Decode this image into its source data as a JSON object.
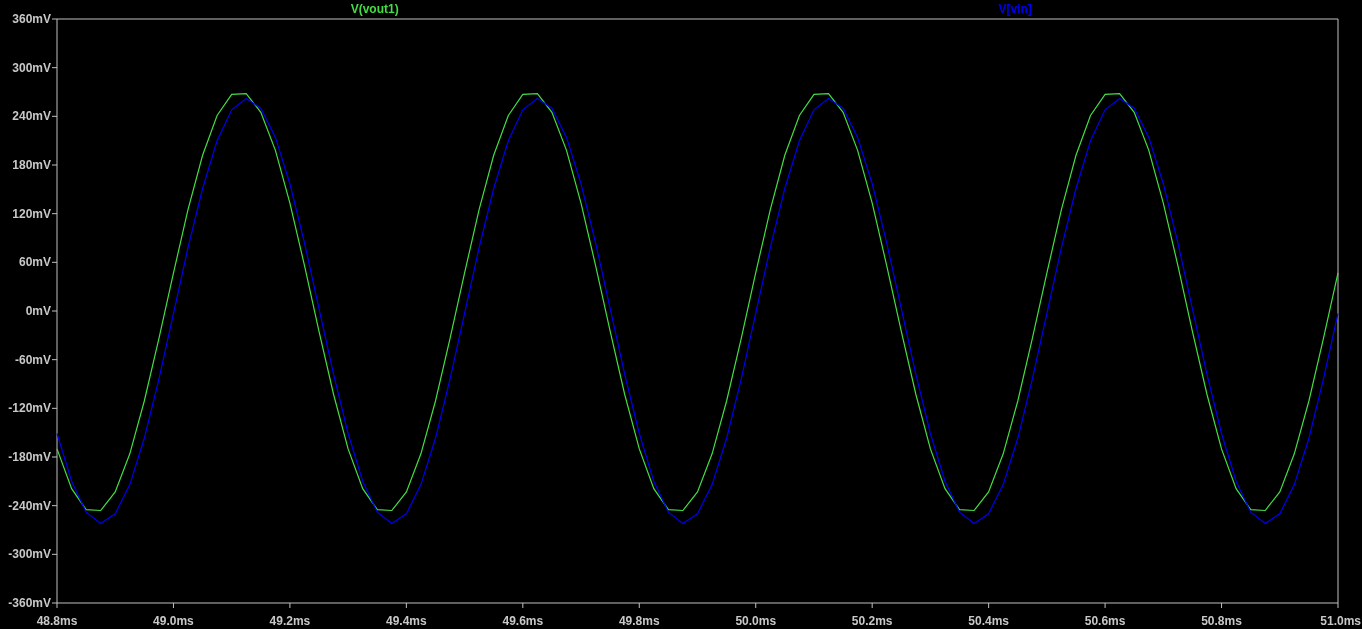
{
  "waveform_viewer": {
    "chart_data": {
      "type": "line",
      "xlim": [
        48.8,
        51
      ],
      "ylim": [
        -360,
        360
      ],
      "xticks": [
        {
          "value": 48.8,
          "label": "48.8ms"
        },
        {
          "value": 49.0,
          "label": "49.0ms"
        },
        {
          "value": 49.2,
          "label": "49.2ms"
        },
        {
          "value": 49.4,
          "label": "49.4ms"
        },
        {
          "value": 49.6,
          "label": "49.6ms"
        },
        {
          "value": 49.8,
          "label": "49.8ms"
        },
        {
          "value": 50.0,
          "label": "50.0ms"
        },
        {
          "value": 50.2,
          "label": "50.2ms"
        },
        {
          "value": 50.4,
          "label": "50.4ms"
        },
        {
          "value": 50.6,
          "label": "50.6ms"
        },
        {
          "value": 50.8,
          "label": "50.8ms"
        },
        {
          "value": 51.0,
          "label": "51.0ms"
        }
      ],
      "yticks": [
        {
          "value": 360,
          "label": "360mV"
        },
        {
          "value": 300,
          "label": "300mV"
        },
        {
          "value": 240,
          "label": "240mV"
        },
        {
          "value": 180,
          "label": "180mV"
        },
        {
          "value": 120,
          "label": "120mV"
        },
        {
          "value": 60,
          "label": "60mV"
        },
        {
          "value": 0,
          "label": "0mV"
        },
        {
          "value": -60,
          "label": "-60mV"
        },
        {
          "value": -120,
          "label": "-120mV"
        },
        {
          "value": -180,
          "label": "-180mV"
        },
        {
          "value": -240,
          "label": "-240mV"
        },
        {
          "value": -300,
          "label": "-300mV"
        },
        {
          "value": -360,
          "label": "-360mV"
        }
      ],
      "x": [
        48.8,
        48.825,
        48.85,
        48.875,
        48.9,
        48.925,
        48.95,
        48.975,
        49,
        49.025,
        49.05,
        49.075,
        49.1,
        49.125,
        49.15,
        49.175,
        49.2,
        49.225,
        49.25,
        49.275,
        49.3,
        49.325,
        49.35,
        49.375,
        49.4,
        49.425,
        49.45,
        49.475,
        49.5,
        49.525,
        49.55,
        49.575,
        49.6,
        49.625,
        49.65,
        49.675,
        49.7,
        49.725,
        49.75,
        49.775,
        49.8,
        49.825,
        49.85,
        49.875,
        49.9,
        49.925,
        49.95,
        49.975,
        50,
        50.025,
        50.05,
        50.075,
        50.1,
        50.125,
        50.15,
        50.175,
        50.2,
        50.225,
        50.25,
        50.275,
        50.3,
        50.325,
        50.35,
        50.375,
        50.4,
        50.425,
        50.45,
        50.475,
        50.5,
        50.525,
        50.55,
        50.575,
        50.6,
        50.625,
        50.65,
        50.675,
        50.7,
        50.725,
        50.75,
        50.775,
        50.8,
        50.825,
        50.85,
        50.875,
        50.9,
        50.925,
        50.95,
        50.975,
        51
      ],
      "series": [
        {
          "name": "V(vout1)",
          "color": "#44dd44",
          "values": [
            -170,
            -219,
            -245,
            -246,
            -223,
            -176,
            -111,
            -34,
            47,
            125,
            192,
            241,
            267,
            268,
            245,
            198,
            133,
            56,
            -25,
            -103,
            -170,
            -219,
            -245,
            -246,
            -223,
            -176,
            -111,
            -34,
            47,
            125,
            192,
            241,
            267,
            268,
            245,
            198,
            133,
            56,
            -25,
            -103,
            -170,
            -219,
            -245,
            -246,
            -223,
            -176,
            -111,
            -34,
            47,
            125,
            192,
            241,
            267,
            268,
            245,
            198,
            133,
            56,
            -25,
            -103,
            -170,
            -219,
            -245,
            -246,
            -223,
            -176,
            -111,
            -34,
            47,
            125,
            192,
            241,
            267,
            268,
            245,
            198,
            133,
            56,
            -25,
            -103,
            -170,
            -219,
            -245,
            -246,
            -223,
            -176,
            -111,
            -34,
            47
          ]
        },
        {
          "name": "V[vin]",
          "color": "#0000ee",
          "values": [
            -151,
            -210,
            -248,
            -262,
            -250,
            -214,
            -157,
            -84,
            -3,
            78,
            151,
            210,
            248,
            262,
            250,
            214,
            157,
            84,
            3,
            -78,
            -151,
            -210,
            -248,
            -262,
            -250,
            -214,
            -157,
            -84,
            -3,
            78,
            151,
            210,
            248,
            262,
            250,
            214,
            157,
            84,
            3,
            -78,
            -151,
            -210,
            -248,
            -262,
            -250,
            -214,
            -157,
            -84,
            -3,
            78,
            151,
            210,
            248,
            262,
            250,
            214,
            157,
            84,
            3,
            -78,
            -151,
            -210,
            -248,
            -262,
            -250,
            -214,
            -157,
            -84,
            -3,
            78,
            151,
            210,
            248,
            262,
            250,
            214,
            157,
            84,
            3,
            -78,
            -151,
            -210,
            -248,
            -262,
            -250,
            -214,
            -157,
            -84,
            -3
          ]
        }
      ]
    }
  }
}
